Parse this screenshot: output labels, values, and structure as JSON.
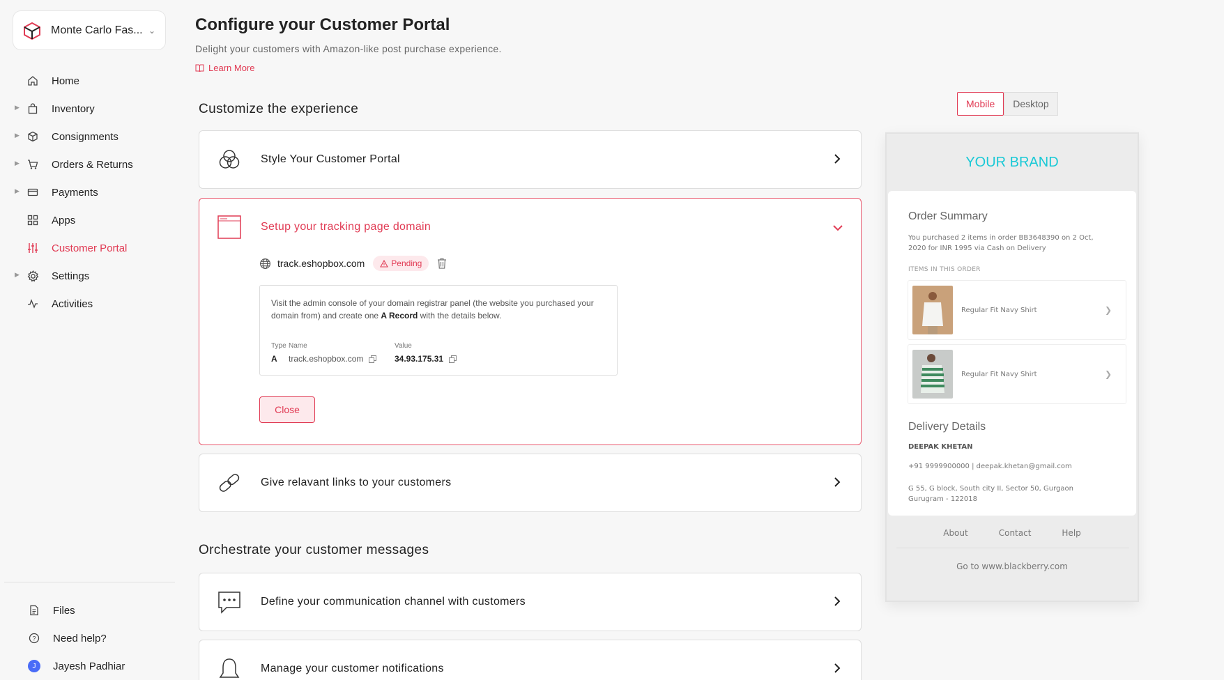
{
  "workspace": {
    "name": "Monte Carlo Fas..."
  },
  "nav": {
    "items": [
      {
        "label": "Home"
      },
      {
        "label": "Inventory"
      },
      {
        "label": "Consignments"
      },
      {
        "label": "Orders & Returns"
      },
      {
        "label": "Payments"
      },
      {
        "label": "Apps"
      },
      {
        "label": "Customer Portal"
      },
      {
        "label": "Settings"
      },
      {
        "label": "Activities"
      }
    ],
    "bottom": [
      {
        "label": "Files"
      },
      {
        "label": "Need help?"
      },
      {
        "label": "Jayesh Padhiar",
        "initial": "J"
      }
    ]
  },
  "header": {
    "title": "Configure your Customer Portal",
    "subtitle": "Delight your customers with Amazon-like post purchase experience.",
    "learn_more": "Learn More"
  },
  "sections": {
    "customize": "Customize the experience",
    "orchestrate": "Orchestrate your customer messages"
  },
  "cards": {
    "style": "Style Your Customer Portal",
    "domain": "Setup your tracking page domain",
    "links": "Give relavant links to your customers",
    "channel": "Define your communication channel with customers",
    "notifications": "Manage your customer notifications"
  },
  "domain_setup": {
    "domain": "track.eshopbox.com",
    "status": "Pending",
    "instructions_1": "Visit the admin console of your domain registrar panel (the website you purchased your domain from) and create one ",
    "instructions_bold": "A Record",
    "instructions_2": " with the details below.",
    "record": {
      "type_label": "Type",
      "type": "A",
      "name_label": "Name",
      "name": "track.eshopbox.com",
      "value_label": "Value",
      "value": "34.93.175.31"
    },
    "close": "Close"
  },
  "preview": {
    "tabs": [
      "Mobile",
      "Desktop"
    ],
    "active_tab": "Mobile",
    "brand": "YOUR BRAND",
    "order_summary": "Order Summary",
    "order_text": "You purchased 2 items in order BB3648390 on 2 Oct, 2020 for INR 1995 via Cash on Delivery",
    "items_label": "ITEMS IN THIS ORDER",
    "items": [
      {
        "name": "Regular Fit Navy Shirt"
      },
      {
        "name": "Regular Fit Navy Shirt"
      }
    ],
    "delivery_title": "Delivery Details",
    "customer_name": "DEEPAK KHETAN",
    "contact": "+91 9999900000 | deepak.khetan@gmail.com",
    "address": "G 55, G block, South city II, Sector 50, Gurgaon Gurugram - 122018",
    "footer_links": [
      "About",
      "Contact",
      "Help"
    ],
    "go_to": "Go to www.blackberry.com"
  },
  "colors": {
    "accent": "#e13b54",
    "brand": "#19c9d6"
  }
}
